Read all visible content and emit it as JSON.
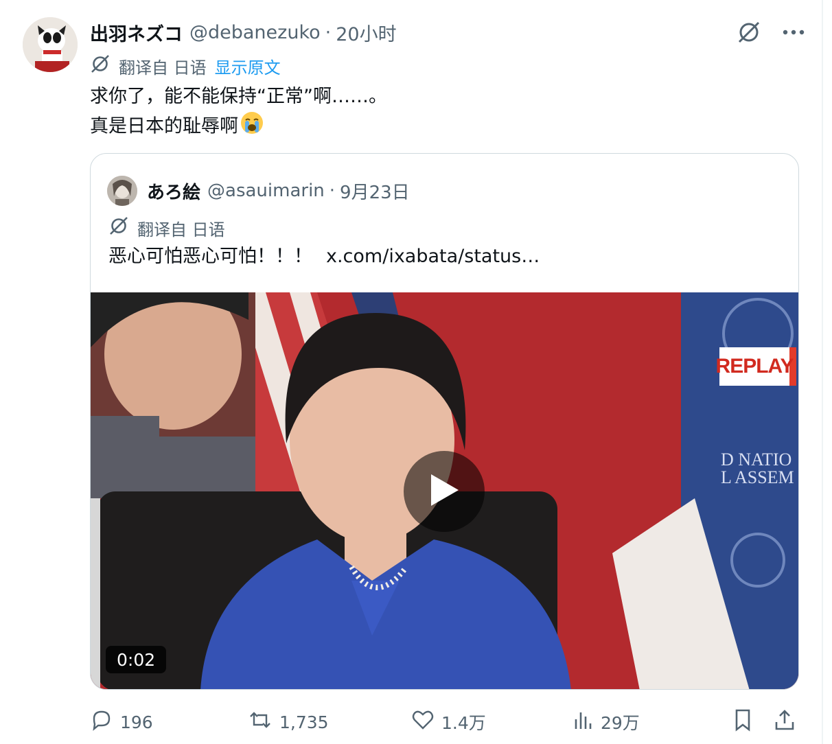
{
  "author": {
    "display_name": "出羽ネズコ",
    "handle": "@debanezuko",
    "separator": "·",
    "time": "20小时"
  },
  "translation": {
    "label": "翻译自 日语",
    "show_original": "显示原文"
  },
  "tweet": {
    "line1": "求你了，能不能保持“正常”啊……。",
    "line2": "真是日本的耻辱啊"
  },
  "quote": {
    "display_name": "あろ絵",
    "handle": "@asauimarin",
    "separator": "·",
    "date": "9月23日",
    "translation_label": "翻译自 日语",
    "text": "恶心可怕恶心可怕！！！",
    "link": "x.com/ixabata/status…",
    "video": {
      "replay_badge": "REPLAY",
      "duration": "0:02",
      "banner_text_1": "D NATIO",
      "banner_text_2": "L ASSEM"
    }
  },
  "actions": {
    "replies": "196",
    "reposts": "1,735",
    "likes": "1.4万",
    "views": "29万"
  },
  "colors": {
    "accent": "#1d9bf0",
    "secondary_text": "#536471",
    "border": "#cfd9de"
  },
  "icons": [
    "grok-slash-icon",
    "more-icon",
    "translate-icon",
    "cry-emoji",
    "play-icon",
    "reply-icon",
    "repost-icon",
    "like-icon",
    "views-icon",
    "bookmark-icon",
    "share-icon"
  ]
}
